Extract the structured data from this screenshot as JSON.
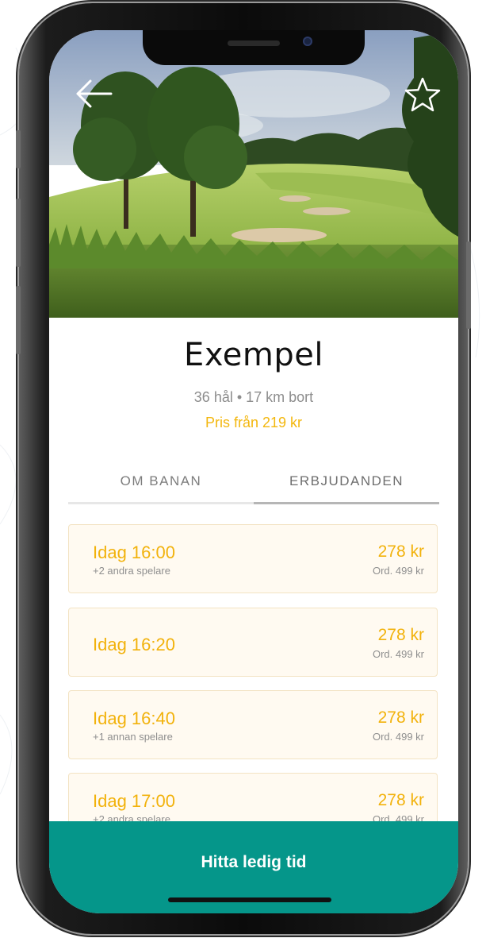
{
  "course": {
    "name": "Exempel",
    "holes_distance": "36 hål • 17 km bort",
    "price_from": "Pris från 219 kr"
  },
  "tabs": [
    {
      "label": "OM BANAN",
      "active": false
    },
    {
      "label": "ERBJUDANDEN",
      "active": true
    }
  ],
  "offers": [
    {
      "time": "Idag 16:00",
      "players": "+2 andra spelare",
      "price": "278 kr",
      "ordinary": "Ord. 499 kr"
    },
    {
      "time": "Idag 16:20",
      "players": "",
      "price": "278 kr",
      "ordinary": "Ord. 499 kr"
    },
    {
      "time": "Idag 16:40",
      "players": "+1 annan spelare",
      "price": "278 kr",
      "ordinary": "Ord. 499 kr"
    },
    {
      "time": "Idag 17:00",
      "players": "+2 andra spelare",
      "price": "278 kr",
      "ordinary": "Ord. 499 kr"
    }
  ],
  "cta": {
    "label": "Hitta ledig tid"
  },
  "icons": {
    "back": "arrow-left-icon",
    "favorite": "star-outline-icon"
  },
  "colors": {
    "accent": "#f2b20c",
    "primary": "#05968a",
    "offer_bg": "#fffaf1"
  }
}
